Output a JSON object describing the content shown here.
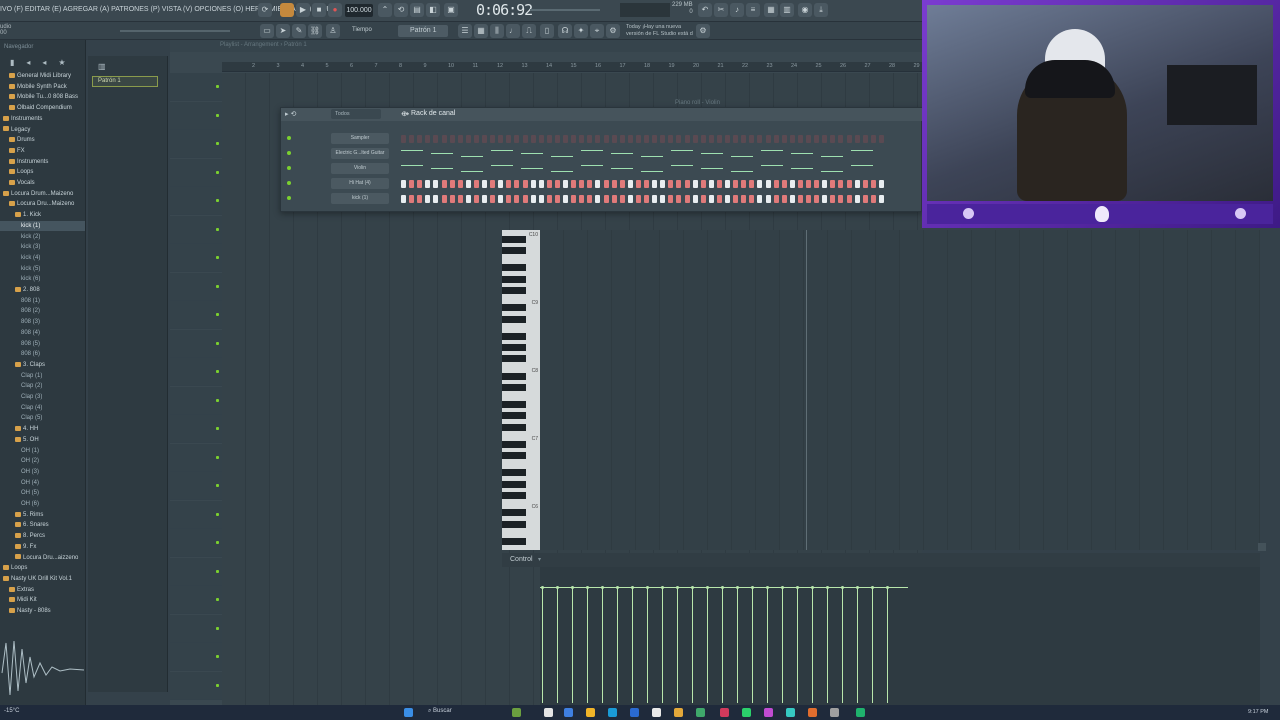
{
  "menu": {
    "text": "IVO (F) EDITAR (E) AGREGAR (A) PATRONES (P) VISTA (V) OPCIONES (O) HERRAMIENTAS (T) AYUDA"
  },
  "transport": {
    "tempo": "100.000",
    "time": "0:06:92",
    "memory_line1": "229 MB",
    "memory_line2": "0"
  },
  "toolbar": {
    "tiempo_label": "Tiempo",
    "pattern_selector": "Patrón 1"
  },
  "news": {
    "line1": "Today ¡Hay una nueva",
    "line2": "versión de FL Studio está d"
  },
  "browser": {
    "title": "Navegador",
    "items": [
      {
        "label": "General Midi Library",
        "depth": 1,
        "folder": true
      },
      {
        "label": "Mobile Synth Pack",
        "depth": 1,
        "folder": true
      },
      {
        "label": "Mobile Tu...0 808 Bass",
        "depth": 1,
        "folder": true
      },
      {
        "label": "Olbaid Compendium",
        "depth": 1,
        "folder": true
      },
      {
        "label": "Instruments",
        "depth": 0,
        "folder": true
      },
      {
        "label": "Legacy",
        "depth": 0,
        "folder": true
      },
      {
        "label": "Drums",
        "depth": 1,
        "folder": true
      },
      {
        "label": "FX",
        "depth": 1,
        "folder": true
      },
      {
        "label": "Instruments",
        "depth": 1,
        "folder": true
      },
      {
        "label": "Loops",
        "depth": 1,
        "folder": true
      },
      {
        "label": "Vocals",
        "depth": 1,
        "folder": true
      },
      {
        "label": "Locura Drum...Maizeno",
        "depth": 0,
        "folder": true
      },
      {
        "label": "Locura Dru...Maizeno",
        "depth": 1,
        "folder": true
      },
      {
        "label": "1. Kick",
        "depth": 2,
        "folder": true
      },
      {
        "label": "kick (1)",
        "depth": 3,
        "folder": false,
        "selected": true
      },
      {
        "label": "kick (2)",
        "depth": 3,
        "folder": false
      },
      {
        "label": "kick (3)",
        "depth": 3,
        "folder": false
      },
      {
        "label": "kick (4)",
        "depth": 3,
        "folder": false
      },
      {
        "label": "kick (5)",
        "depth": 3,
        "folder": false
      },
      {
        "label": "kick (6)",
        "depth": 3,
        "folder": false
      },
      {
        "label": "2. 808",
        "depth": 2,
        "folder": true
      },
      {
        "label": "808 (1)",
        "depth": 3,
        "folder": false
      },
      {
        "label": "808 (2)",
        "depth": 3,
        "folder": false
      },
      {
        "label": "808 (3)",
        "depth": 3,
        "folder": false
      },
      {
        "label": "808 (4)",
        "depth": 3,
        "folder": false
      },
      {
        "label": "808 (5)",
        "depth": 3,
        "folder": false
      },
      {
        "label": "808 (6)",
        "depth": 3,
        "folder": false
      },
      {
        "label": "3. Claps",
        "depth": 2,
        "folder": true
      },
      {
        "label": "Clap (1)",
        "depth": 3,
        "folder": false
      },
      {
        "label": "Clap (2)",
        "depth": 3,
        "folder": false
      },
      {
        "label": "Clap (3)",
        "depth": 3,
        "folder": false
      },
      {
        "label": "Clap (4)",
        "depth": 3,
        "folder": false
      },
      {
        "label": "Clap (5)",
        "depth": 3,
        "folder": false
      },
      {
        "label": "4. HH",
        "depth": 2,
        "folder": true
      },
      {
        "label": "5. OH",
        "depth": 2,
        "folder": true
      },
      {
        "label": "OH (1)",
        "depth": 3,
        "folder": false
      },
      {
        "label": "OH (2)",
        "depth": 3,
        "folder": false
      },
      {
        "label": "OH (3)",
        "depth": 3,
        "folder": false
      },
      {
        "label": "OH (4)",
        "depth": 3,
        "folder": false
      },
      {
        "label": "OH (5)",
        "depth": 3,
        "folder": false
      },
      {
        "label": "OH (6)",
        "depth": 3,
        "folder": false
      },
      {
        "label": "5. Rims",
        "depth": 2,
        "folder": true
      },
      {
        "label": "6. Snares",
        "depth": 2,
        "folder": true
      },
      {
        "label": "8. Percs",
        "depth": 2,
        "folder": true
      },
      {
        "label": "9. Fx",
        "depth": 2,
        "folder": true
      },
      {
        "label": "Locura Dru...aizzeno",
        "depth": 2,
        "folder": true
      },
      {
        "label": "Loops",
        "depth": 0,
        "folder": true
      },
      {
        "label": "Nasty UK Drill Kit Vol.1",
        "depth": 0,
        "folder": true
      },
      {
        "label": "Extras",
        "depth": 1,
        "folder": true
      },
      {
        "label": "Midi Kit",
        "depth": 1,
        "folder": true
      },
      {
        "label": "Nasty - 808s",
        "depth": 1,
        "folder": true
      }
    ]
  },
  "patterns": {
    "selected": "Patrón 1"
  },
  "playlist": {
    "title": "Playlist - Arrangement › Patrón 1",
    "ruler": [
      "2",
      "3",
      "4",
      "5",
      "6",
      "7",
      "8",
      "9",
      "10",
      "11",
      "12",
      "13",
      "14",
      "15",
      "16",
      "17",
      "18",
      "19",
      "20",
      "21",
      "22",
      "23",
      "24",
      "25",
      "26",
      "27",
      "28",
      "29"
    ]
  },
  "rack": {
    "title": "Rack de canal",
    "filter": "Todos",
    "channels": [
      {
        "name": "Sampler",
        "pattern": "steps-empty"
      },
      {
        "name": "Electric G...lted Guitar",
        "pattern": "notes"
      },
      {
        "name": "Violin",
        "pattern": "notes"
      },
      {
        "name": "Hi Hat (4)",
        "pattern": "steps"
      },
      {
        "name": "kick (1)",
        "pattern": "steps"
      }
    ],
    "accent_color": "#e07a7a"
  },
  "piano_roll": {
    "title": "Piano roll - Violin",
    "octaves": [
      "C10",
      "C9",
      "C8",
      "C7",
      "C6"
    ]
  },
  "control": {
    "label": "Control"
  },
  "velocity": {
    "count": 24
  },
  "taskbar": {
    "weather": "-15°C",
    "search": "Buscar",
    "clock": "9:17 PM"
  }
}
